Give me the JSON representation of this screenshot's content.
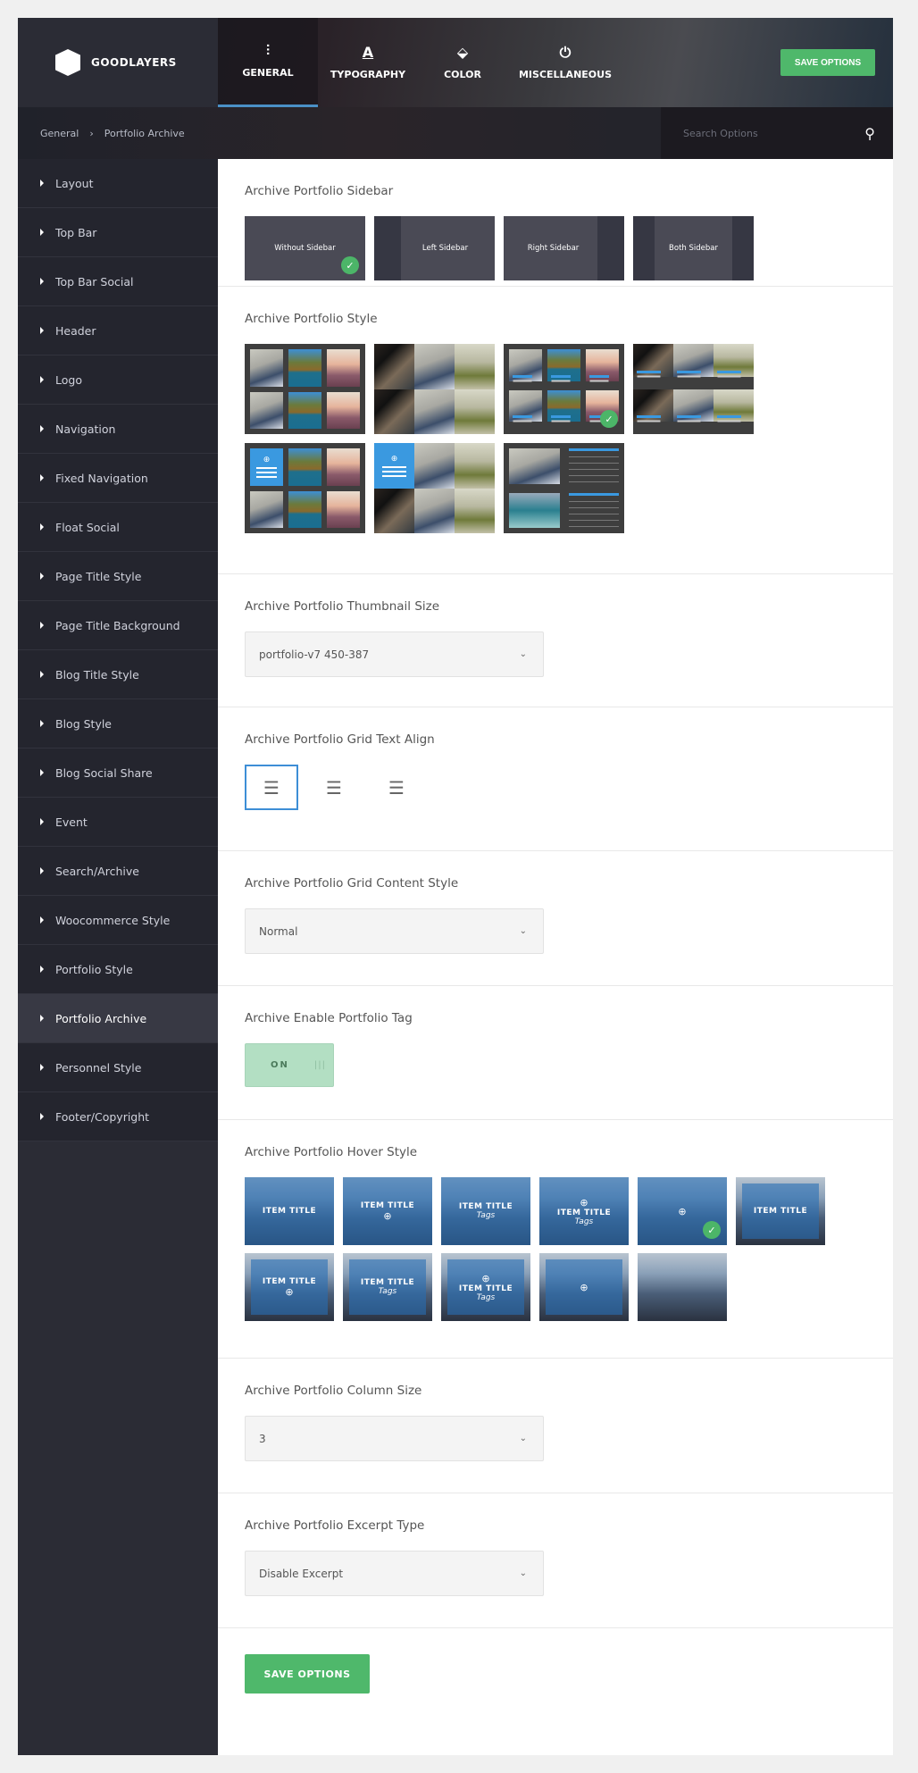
{
  "brand": {
    "name": "GOODLAYERS"
  },
  "nav": {
    "tabs": [
      {
        "label": "GENERAL",
        "icon": "sliders-icon",
        "active": true
      },
      {
        "label": "TYPOGRAPHY",
        "icon": "font-icon"
      },
      {
        "label": "COLOR",
        "icon": "paint-bucket-icon"
      },
      {
        "label": "MISCELLANEOUS",
        "icon": "plug-icon"
      }
    ],
    "save_label": "SAVE OPTIONS"
  },
  "breadcrumb": {
    "items": [
      "General",
      "Portfolio Archive"
    ],
    "separator": "›"
  },
  "search": {
    "placeholder": "Search Options",
    "value": ""
  },
  "sidebar": {
    "active": "Portfolio Archive",
    "items": [
      "Layout",
      "Top Bar",
      "Top Bar Social",
      "Header",
      "Logo",
      "Navigation",
      "Fixed Navigation",
      "Float Social",
      "Page Title Style",
      "Page Title Background",
      "Blog Title Style",
      "Blog Style",
      "Blog Social Share",
      "Event",
      "Search/Archive",
      "Woocommerce Style",
      "Portfolio Style",
      "Portfolio Archive",
      "Personnel Style",
      "Footer/Copyright"
    ]
  },
  "sections": {
    "sidebar": {
      "title": "Archive Portfolio Sidebar",
      "options": [
        "Without Sidebar",
        "Left Sidebar",
        "Right Sidebar",
        "Both Sidebar"
      ],
      "selected": "Without Sidebar"
    },
    "style": {
      "title": "Archive Portfolio Style",
      "selected_index": 2
    },
    "thumb_size": {
      "title": "Archive Portfolio Thumbnail Size",
      "value": "portfolio-v7 450-387"
    },
    "text_align": {
      "title": "Archive Portfolio Grid Text Align",
      "options": [
        "left",
        "center",
        "right"
      ],
      "selected": "left"
    },
    "content_style": {
      "title": "Archive Portfolio Grid Content Style",
      "value": "Normal"
    },
    "tag": {
      "title": "Archive Enable Portfolio Tag",
      "value": "ON"
    },
    "hover": {
      "title": "Archive Portfolio Hover Style",
      "item_title": "ITEM TITLE",
      "tags": "Tags",
      "selected_index": 4
    },
    "columns": {
      "title": "Archive Portfolio Column Size",
      "value": "3"
    },
    "excerpt": {
      "title": "Archive Portfolio Excerpt Type",
      "value": "Disable Excerpt"
    }
  },
  "footer": {
    "save_label": "SAVE OPTIONS"
  },
  "colors": {
    "accent": "#4fb86b",
    "active_tab": "#4a90c6",
    "selected_border": "#3d8ed6",
    "sidebar_bg": "#2b2c35"
  }
}
